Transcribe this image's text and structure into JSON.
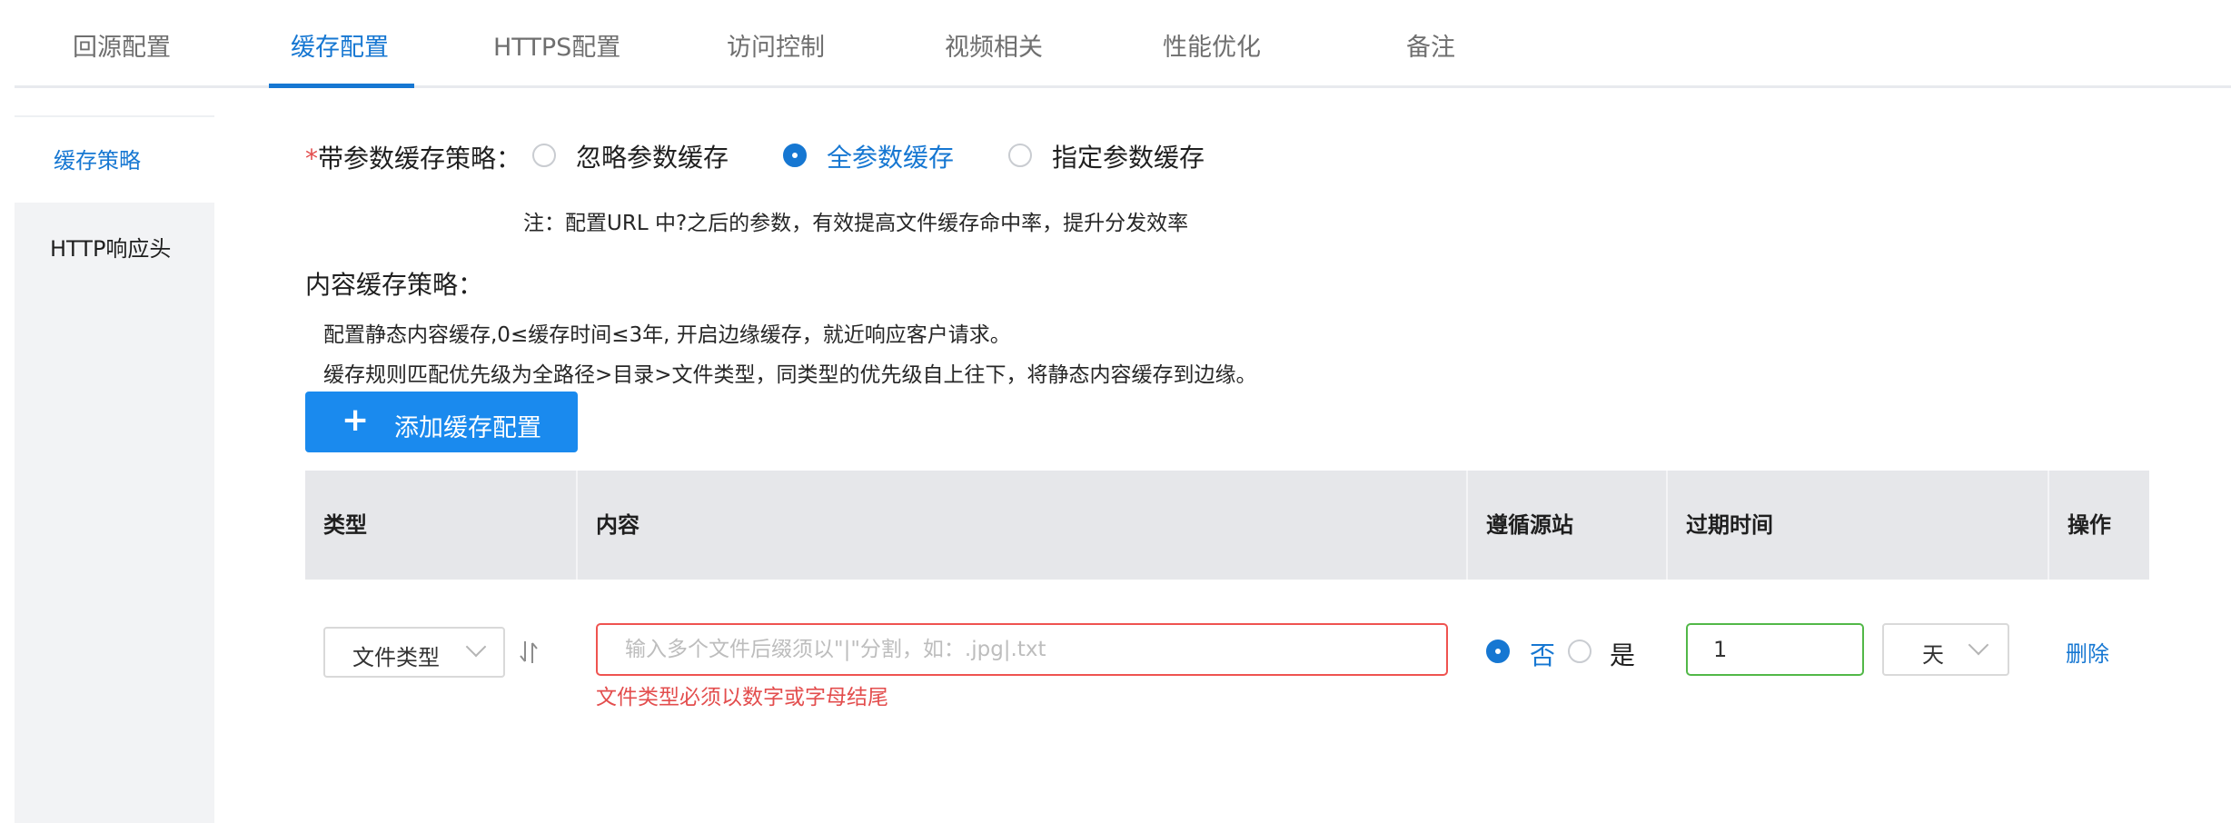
{
  "tabs": [
    {
      "label": "回源配置",
      "active": false
    },
    {
      "label": "缓存配置",
      "active": true
    },
    {
      "label": "HTTPS配置",
      "active": false
    },
    {
      "label": "访问控制",
      "active": false
    },
    {
      "label": "视频相关",
      "active": false
    },
    {
      "label": "性能优化",
      "active": false
    },
    {
      "label": "备注",
      "active": false
    }
  ],
  "sidebar": {
    "items": [
      {
        "label": "缓存策略",
        "active": true
      },
      {
        "label": "HTTP响应头",
        "active": false
      }
    ]
  },
  "param_cache": {
    "required_mark": "*",
    "label": "带参数缓存策略：",
    "options": [
      {
        "label": "忽略参数缓存",
        "checked": false
      },
      {
        "label": "全参数缓存",
        "checked": true
      },
      {
        "label": "指定参数缓存",
        "checked": false
      }
    ],
    "note": "注：配置URL 中?之后的参数，有效提高文件缓存命中率，提升分发效率"
  },
  "content_cache": {
    "label": "内容缓存策略：",
    "desc_1": "配置静态内容缓存,0≤缓存时间≤3年, 开启边缘缓存，就近响应客户请求。",
    "desc_2": "缓存规则匹配优先级为全路径>目录>文件类型，同类型的优先级自上往下，将静态内容缓存到边缘。"
  },
  "add_button": {
    "icon": "+",
    "label": "添加缓存配置"
  },
  "table": {
    "columns": [
      "类型",
      "内容",
      "遵循源站",
      "过期时间",
      "操作"
    ],
    "row": {
      "type_value": "文件类型",
      "content_placeholder": "输入多个文件后缀须以\"|\"分割，如：.jpg|.txt",
      "content_error": "文件类型必须以数字或字母结尾",
      "follow_origin": [
        {
          "label": "否",
          "checked": true
        },
        {
          "label": "是",
          "checked": false
        }
      ],
      "expire_value": "1",
      "expire_unit": "天",
      "action": "删除"
    }
  },
  "colors": {
    "accent": "#1677d2",
    "button": "#1a8aee",
    "error": "#e34d4d",
    "valid": "#52b848"
  }
}
